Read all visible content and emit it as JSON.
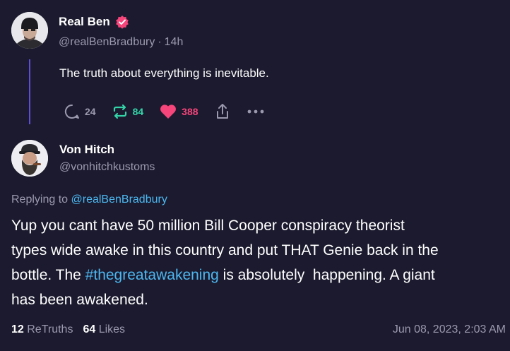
{
  "original_post": {
    "author_name": "Real Ben",
    "handle": "@realBenBradbury",
    "separator": "·",
    "time_ago": "14h",
    "text": "The truth about everything is inevitable.",
    "actions": {
      "reply_count": "24",
      "retruth_count": "84",
      "like_count": "388"
    }
  },
  "reply_post": {
    "author_name": "Von Hitch",
    "handle": "@vonhitchkustoms",
    "replying_to_label": "Replying to",
    "replying_to_handle": "@realBenBradbury",
    "body": {
      "line1": "Yup you cant have 50 million Bill Cooper conspiracy theorist",
      "line2": "types wide awake in this country and put THAT Genie back in the",
      "line3_before": "bottle. The ",
      "hashtag": "#thegreatawakening",
      "line3_after": " is absolutely  happening. A giant",
      "line4": "has been awakened."
    },
    "stats": {
      "retruths_count": "12",
      "retruths_label": "ReTruths",
      "likes_count": "64",
      "likes_label": "Likes"
    },
    "date": "Jun 08, 2023, 2:03 AM"
  },
  "colors": {
    "background": "#1b1a2e",
    "thread_line": "#5b4fd6",
    "muted_text": "#9b99ad",
    "link": "#4db7f0",
    "retruth": "#34d3a8",
    "like": "#f5457a",
    "verified_badge": "#f5457a"
  },
  "icons": {
    "reply": "reply-bubble-icon",
    "retruth": "retruth-icon",
    "like": "heart-icon",
    "share": "share-icon",
    "more": "more-dots-icon",
    "verified": "verified-badge-icon"
  }
}
